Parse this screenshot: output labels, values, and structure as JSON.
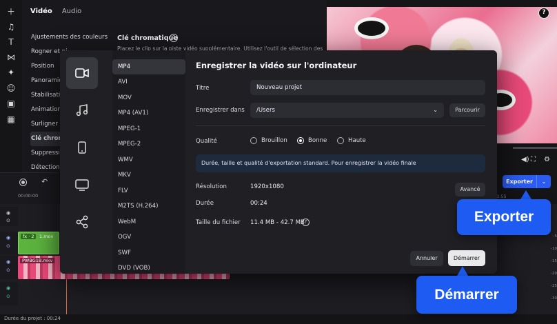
{
  "sidebar_tools": [
    "plus-icon",
    "music-note-icon",
    "text-icon",
    "transition-icon",
    "magic-wand-icon",
    "sticker-icon",
    "overlay-icon",
    "apps-icon"
  ],
  "props_panel": {
    "tabs": [
      "Vidéo",
      "Audio"
    ],
    "items": [
      "Ajustements des couleurs",
      "Rogner et pi",
      "Position",
      "Panoramiq",
      "Stabilisation",
      "Animation",
      "Surligner et",
      "Clé chroma",
      "Suppression",
      "Détection de"
    ],
    "chroma_title": "Clé chromatique",
    "chroma_desc": "Placez le clip sur la piste vidéo supplémentaire. Utilisez l'outil de sélection des"
  },
  "app_export": {
    "label": "Exporter",
    "time_tick": "0:55"
  },
  "timeline": {
    "ruler_time": "00:00:00",
    "clip1_tag": "fx · 2",
    "clip1_name": "1.mov",
    "clip2_name": "PWBG1B.mkv",
    "status": "Durée du projet : 00:24",
    "vol_marks": [
      "-5",
      "-10",
      "-15",
      "-20",
      "-25",
      "-30"
    ]
  },
  "dialog": {
    "title": "Enregistrer la vidéo sur l'ordinateur",
    "formats": [
      "MP4",
      "AVI",
      "MOV",
      "MP4 (AV1)",
      "MPEG-1",
      "MPEG-2",
      "WMV",
      "MKV",
      "FLV",
      "M2TS (H.264)",
      "WebM",
      "OGV",
      "SWF",
      "DVD (VOB)"
    ],
    "title_label": "Titre",
    "title_value": "Nouveau projet",
    "save_label": "Enregistrer dans",
    "save_value": "/Users",
    "browse": "Parcourir",
    "quality_label": "Qualité",
    "quality_options": [
      "Brouillon",
      "Bonne",
      "Haute"
    ],
    "quality_selected": "Bonne",
    "info": "Durée, taille et qualité d'exportation standard. Pour enregistrer la vidéo finale",
    "resolution_label": "Résolution",
    "resolution_value": "1920x1080",
    "advanced": "Avancé",
    "duration_label": "Durée",
    "duration_value": "00:24",
    "filesize_label": "Taille du fichier",
    "filesize_value": "11.4 MB - 42.7 MB",
    "cancel": "Annuler",
    "start": "Démarrer"
  },
  "callouts": {
    "export": "Exporter",
    "start": "Démarrer"
  },
  "colors": {
    "accent": "#1d5bf2",
    "export_button": "#2b5bf0",
    "clip_green": "#5cb43f",
    "clip_pink": "#e94a7a"
  }
}
